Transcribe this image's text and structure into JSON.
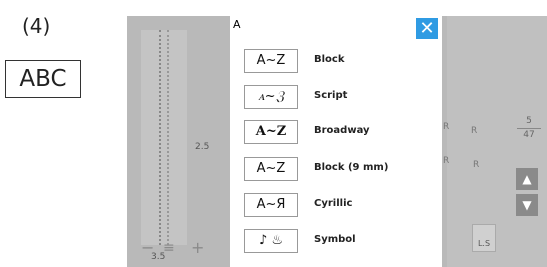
{
  "step_label": "(4)",
  "preview_text": "ABC",
  "dialog": {
    "title": "A",
    "close_glyph": "✕",
    "fonts": [
      {
        "sample": "A~Z",
        "label": "Block"
      },
      {
        "sample": "ꭺ~ℨ",
        "label": "Script"
      },
      {
        "sample": "A~Z",
        "label": "Broadway"
      },
      {
        "sample": "A~Z",
        "label": "Block (9 mm)"
      },
      {
        "sample": "A~Я",
        "label": "Cyrillic"
      },
      {
        "sample": "♪ ♨",
        "label": "Symbol"
      }
    ]
  },
  "background": {
    "value_left": "3.5",
    "value_mid": "2.5",
    "fraction_top": "5",
    "fraction_bottom": "47",
    "ls_label": "L.S",
    "r_mark": "R",
    "minus": "−",
    "plus": "+",
    "eq": "≡",
    "up_arrow": "▲",
    "down_arrow": "▼"
  },
  "colors": {
    "close_button": "#2f9be3"
  }
}
